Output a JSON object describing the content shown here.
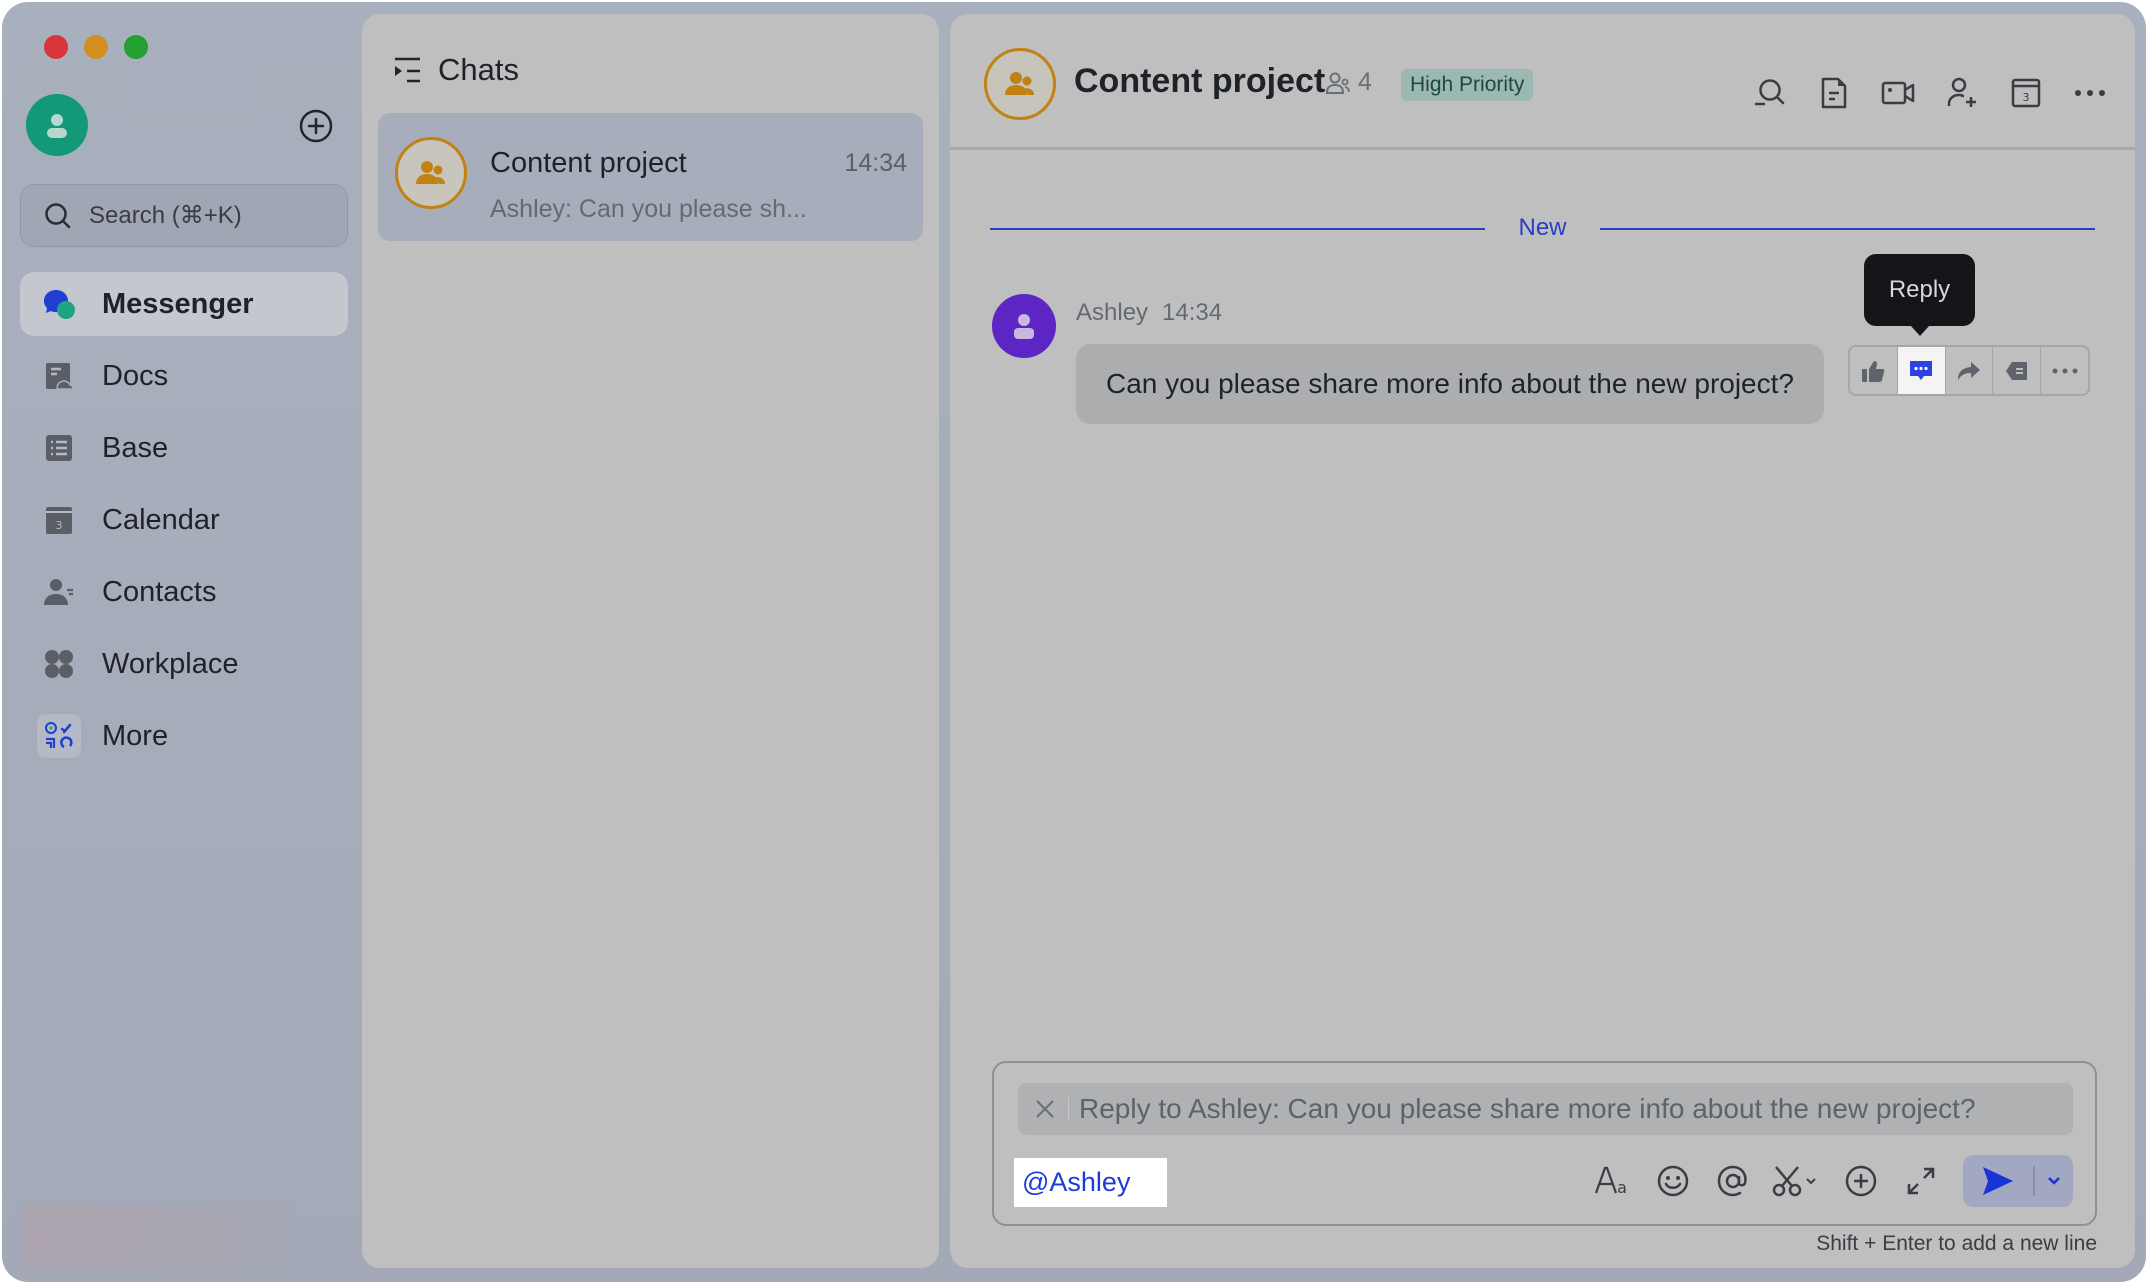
{
  "window": {
    "traffic_lights": [
      "close",
      "minimize",
      "maximize"
    ]
  },
  "sidebar": {
    "avatar_icon": "user-avatar-icon",
    "add_icon": "plus-circle-icon",
    "search_placeholder": "Search (⌘+K)",
    "items": [
      {
        "label": "Messenger",
        "icon": "messenger-icon",
        "active": true
      },
      {
        "label": "Docs",
        "icon": "docs-icon",
        "active": false
      },
      {
        "label": "Base",
        "icon": "base-icon",
        "active": false
      },
      {
        "label": "Calendar",
        "icon": "calendar-icon",
        "active": false
      },
      {
        "label": "Contacts",
        "icon": "contacts-icon",
        "active": false
      },
      {
        "label": "Workplace",
        "icon": "workplace-icon",
        "active": false
      },
      {
        "label": "More",
        "icon": "more-apps-icon",
        "active": false
      }
    ]
  },
  "chats": {
    "title": "Chats",
    "items": [
      {
        "title": "Content project",
        "time": "14:34",
        "preview": "Ashley: Can you please sh..."
      }
    ]
  },
  "chat": {
    "title": "Content project",
    "member_count": "4",
    "badge": "High Priority",
    "header_icons": [
      "search-history-icon",
      "document-icon",
      "video-call-icon",
      "add-member-icon",
      "calendar-icon",
      "more-icon"
    ],
    "divider_label": "New",
    "messages": [
      {
        "sender": "Ashley",
        "time": "14:34",
        "text": "Can you please share more info about the new project?"
      }
    ],
    "tooltip": "Reply",
    "message_actions": [
      "thumbs-up-icon",
      "reply-icon",
      "forward-icon",
      "quote-icon",
      "more-icon"
    ],
    "composer": {
      "reply_preview": "Reply to Ashley: Can you please share more info about the new project?",
      "mention": "@Ashley",
      "tools": [
        "text-format-icon",
        "emoji-icon",
        "mention-icon",
        "screenshot-icon",
        "add-icon",
        "expand-icon"
      ],
      "hint": "Shift + Enter to add a new line"
    }
  },
  "colors": {
    "accent": "#2a3fc0",
    "group_avatar_border": "#c18113",
    "sender_avatar": "#5c25c4",
    "user_avatar": "#139978",
    "badge_bg": "#9bb8b2"
  }
}
